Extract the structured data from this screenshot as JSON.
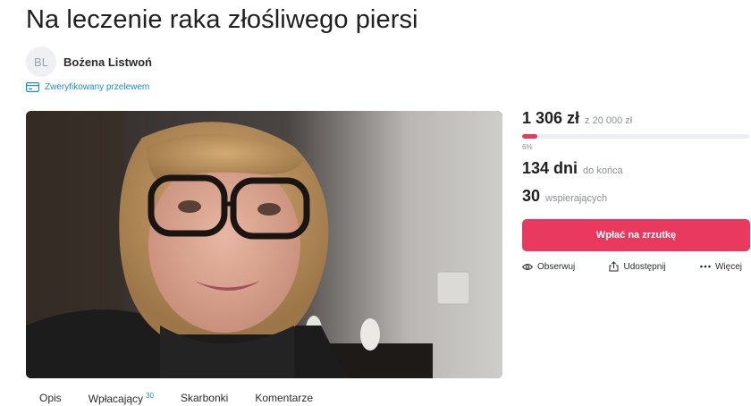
{
  "campaign": {
    "title": "Na leczenie raka złośliwego piersi",
    "author": {
      "initials": "BL",
      "name": "Bożena Listwoń"
    },
    "verified_label": "Zweryfikowany przelewem"
  },
  "tabs": [
    {
      "label": "Opis"
    },
    {
      "label": "Wpłacający",
      "count": "30"
    },
    {
      "label": "Skarbonki"
    },
    {
      "label": "Komentarze"
    }
  ],
  "funding": {
    "raised": "1 306 zł",
    "goal": "z 20 000 zł",
    "percent_label": "6%",
    "progress_fraction": 0.065
  },
  "stats": {
    "days": "134 dni",
    "days_label": "do końca",
    "backers": "30",
    "backers_label": "wspierających"
  },
  "donate_label": "Wpłać na zrzutkę",
  "actions": {
    "follow": "Obserwuj",
    "share": "Udostępnij",
    "more": "Więcej"
  },
  "colors": {
    "accent": "#e9395e",
    "link": "#1a8ccf"
  },
  "icons": [
    "verified-card-icon",
    "eye-icon",
    "share-icon",
    "more-dots-icon"
  ]
}
